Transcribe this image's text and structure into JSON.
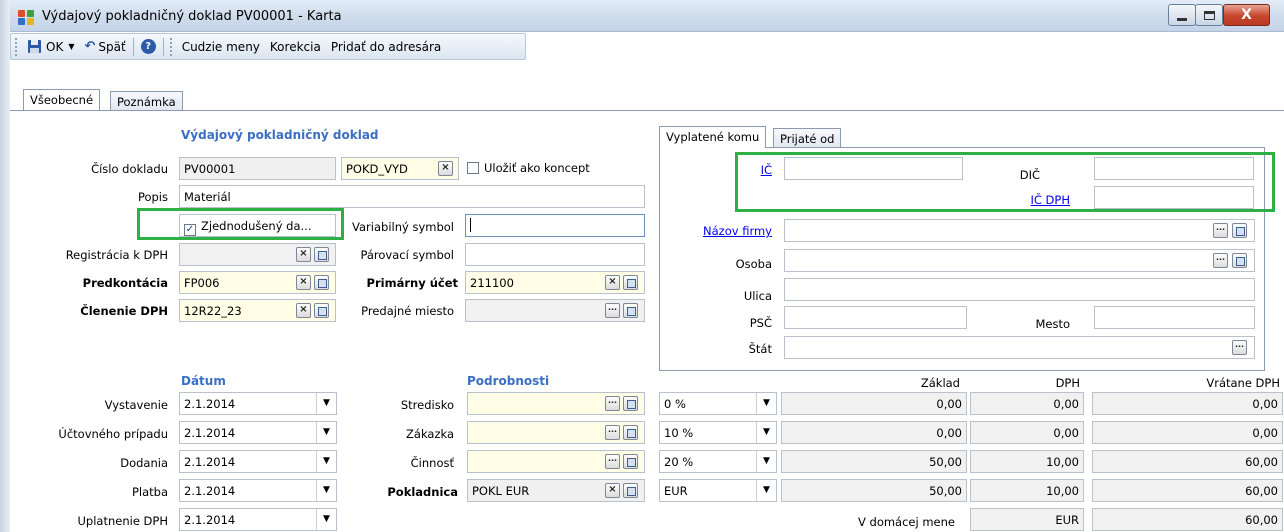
{
  "window": {
    "title": "Výdajový pokladničný doklad PV00001 - Karta",
    "close_label": "X"
  },
  "toolbar": {
    "ok": "OK",
    "back": "Späť",
    "foreign_currencies": "Cudzie meny",
    "correction": "Korekcia",
    "add_to_address_book": "Pridať do adresára"
  },
  "tabs": {
    "general": "Všeobecné",
    "note": "Poznámka",
    "paid_to": "Vyplatené komu",
    "received_from": "Prijaté od"
  },
  "doc": {
    "header": "Výdajový pokladničný doklad",
    "number_label": "Číslo dokladu",
    "number": "PV00001",
    "series": "POKD_VYD",
    "save_draft": "Uložiť ako koncept",
    "desc_label": "Popis",
    "desc": "Materiál",
    "simplified": "Zjednodušený da...",
    "variable_symbol_label": "Variabilný symbol",
    "variable_symbol": "",
    "vat_reg_label": "Registrácia k DPH",
    "pairing_symbol_label": "Párovací symbol",
    "predkontacia_label": "Predkontácia",
    "predkontacia": "FP006",
    "primary_account_label": "Primárny účet",
    "primary_account": "211100",
    "vat_breakdown_label": "Členenie DPH",
    "vat_breakdown": "12R22_23",
    "sales_point_label": "Predajné miesto"
  },
  "partner": {
    "ico_label": "IČ",
    "dic_label": "DIČ",
    "icdph_label": "IČ DPH",
    "company_label": "Názov firmy",
    "person_label": "Osoba",
    "street_label": "Ulica",
    "zip_label": "PSČ",
    "city_label": "Mesto",
    "country_label": "Štát"
  },
  "dates": {
    "header": "Dátum",
    "rows": [
      {
        "label": "Vystavenie",
        "value": "2.1.2014"
      },
      {
        "label": "Účtovného prípadu",
        "value": "2.1.2014"
      },
      {
        "label": "Dodania",
        "value": "2.1.2014"
      },
      {
        "label": "Platba",
        "value": "2.1.2014"
      },
      {
        "label": "Uplatnenie DPH",
        "value": "2.1.2014"
      }
    ]
  },
  "details": {
    "header": "Podrobnosti",
    "center_label": "Stredisko",
    "order_label": "Zákazka",
    "activity_label": "Činnosť",
    "cashbox_label": "Pokladnica",
    "cashbox": "POKL EUR"
  },
  "vat_table": {
    "col_base": "Základ",
    "col_vat": "DPH",
    "col_total": "Vrátane DPH",
    "rows": [
      {
        "rate": "0 %",
        "base": "0,00",
        "vat": "0,00",
        "total": "0,00"
      },
      {
        "rate": "10 %",
        "base": "0,00",
        "vat": "0,00",
        "total": "0,00"
      },
      {
        "rate": "20 %",
        "base": "50,00",
        "vat": "10,00",
        "total": "60,00"
      },
      {
        "rate": "EUR",
        "base": "50,00",
        "vat": "10,00",
        "total": "60,00"
      }
    ],
    "domestic_label": "V domácej mene",
    "domestic_currency": "EUR",
    "domestic_total": "60,00"
  },
  "colors": {
    "highlight_frame": "#2fb044",
    "link": "#0000ee",
    "section_header": "#3b6fc3",
    "required_bg": "#fffde6"
  }
}
